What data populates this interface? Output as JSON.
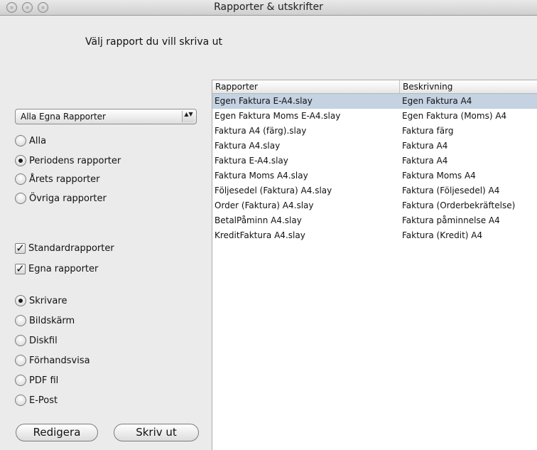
{
  "window": {
    "title": "Rapporter & utskrifter"
  },
  "heading": "Välj rapport du vill skriva ut",
  "report_filter": {
    "selected": "Alla Egna Rapporter",
    "arrows": "▲▼"
  },
  "period_options": [
    {
      "label": "Alla",
      "selected": false
    },
    {
      "label": "Periodens rapporter",
      "selected": true
    },
    {
      "label": "Årets rapporter",
      "selected": false
    },
    {
      "label": "Övriga rapporter",
      "selected": false
    }
  ],
  "checkboxes": [
    {
      "label": "Standardrapporter",
      "checked": true,
      "mark": "✓"
    },
    {
      "label": "Egna rapporter",
      "checked": true,
      "mark": "✓"
    }
  ],
  "output_options": [
    {
      "label": "Skrivare",
      "selected": true
    },
    {
      "label": "Bildskärm",
      "selected": false
    },
    {
      "label": "Diskfil",
      "selected": false
    },
    {
      "label": "Förhandsvisa",
      "selected": false
    },
    {
      "label": "PDF fil",
      "selected": false
    },
    {
      "label": "E-Post",
      "selected": false
    }
  ],
  "buttons": {
    "edit": "Redigera",
    "print": "Skriv ut"
  },
  "table": {
    "columns": [
      "Rapporter",
      "Beskrivning"
    ],
    "rows": [
      {
        "file": "Egen Faktura E-A4.slay",
        "desc": "Egen Faktura A4",
        "selected": true
      },
      {
        "file": "Egen Faktura Moms E-A4.slay",
        "desc": "Egen Faktura (Moms) A4",
        "selected": false
      },
      {
        "file": "Faktura A4 (färg).slay",
        "desc": "Faktura färg",
        "selected": false
      },
      {
        "file": "Faktura A4.slay",
        "desc": "Faktura A4",
        "selected": false
      },
      {
        "file": "Faktura E-A4.slay",
        "desc": "Faktura A4",
        "selected": false
      },
      {
        "file": "Faktura Moms A4.slay",
        "desc": "Faktura Moms A4",
        "selected": false
      },
      {
        "file": "Följesedel (Faktura) A4.slay",
        "desc": "Faktura (Följesedel) A4",
        "selected": false
      },
      {
        "file": "Order (Faktura) A4.slay",
        "desc": "Faktura (Orderbekräftelse)",
        "selected": false
      },
      {
        "file": "BetalPåminn A4.slay",
        "desc": "Faktura påminnelse A4",
        "selected": false
      },
      {
        "file": "KreditFaktura A4.slay",
        "desc": "Faktura (Kredit) A4",
        "selected": false
      }
    ]
  }
}
